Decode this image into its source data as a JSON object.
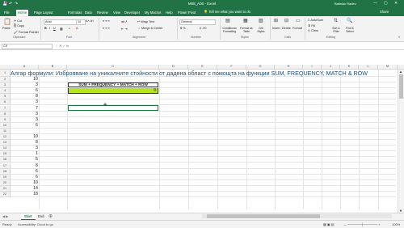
{
  "titlebar": {
    "file_title": "M08_A00 - Excel",
    "user": "Batislav Radev",
    "minimize": "—",
    "maximize": "▢",
    "close": "✕"
  },
  "tabs": [
    {
      "label": "File"
    },
    {
      "label": "Home"
    },
    {
      "label": "Page Layout"
    },
    {
      "label": "Formulas"
    },
    {
      "label": "Data"
    },
    {
      "label": "Review"
    },
    {
      "label": "View"
    },
    {
      "label": "Developer"
    },
    {
      "label": "My Macros"
    },
    {
      "label": "Help"
    },
    {
      "label": "Power Pivot"
    }
  ],
  "tell_me": "Tell me what you want to do",
  "share": "Share",
  "ribbon": {
    "clipboard": {
      "label": "Clipboard",
      "paste": "Paste",
      "cut": "Cut",
      "copy": "Copy",
      "format_painter": "Format Painter"
    },
    "font": {
      "label": "Font",
      "family": "Arial",
      "size": "10"
    },
    "alignment": {
      "label": "Alignment",
      "wrap": "Wrap Text",
      "merge": "Merge & Center"
    },
    "number": {
      "label": "Number",
      "format": "General"
    },
    "styles": {
      "label": "Styles",
      "cond": "Conditional Formatting",
      "table": "Format as Table",
      "cell": "Cell Styles"
    },
    "cells": {
      "label": "Cells",
      "insert": "Insert",
      "delete": "Delete",
      "format": "Format"
    },
    "editing": {
      "label": "Editing",
      "autosum": "AutoSum",
      "fill": "Fill",
      "clear": "Clear",
      "sort": "Sort & Filter",
      "find": "Find & Select"
    }
  },
  "namebox": "C5",
  "fx_icons": "⋮  ✕  ✓  fx",
  "columns": [
    "A",
    "B",
    "C",
    "D",
    "E",
    "F",
    "G",
    "H",
    "I",
    "J",
    "K",
    "L",
    "M"
  ],
  "rows": [
    "1",
    "2",
    "3",
    "4",
    "5",
    "6",
    "7",
    "8",
    "9",
    "10",
    "11",
    "12",
    "13",
    "14",
    "15",
    "16",
    "17",
    "18",
    "19",
    "20",
    "21",
    "22"
  ],
  "title_text": "Алгар формули: Изброяване на уникалните стойности от дадена област с помощта на функции SUM, FREQUENCY, MATCH & ROW",
  "column_a": [
    "10",
    "3",
    "6",
    "8",
    "3",
    "7",
    "3",
    "3",
    "6",
    "",
    "10",
    "8",
    "3",
    "1",
    "5",
    "8",
    "6",
    "6",
    "10",
    "14",
    "18"
  ],
  "formula_header": "SUM + FREQUENCY + MATCH + ROW",
  "result": "9",
  "sheets": [
    {
      "label": "Start"
    },
    {
      "label": "End"
    }
  ],
  "status": {
    "ready": "Ready",
    "accessibility": "Accessibility: Good to go",
    "zoom": "100%"
  }
}
